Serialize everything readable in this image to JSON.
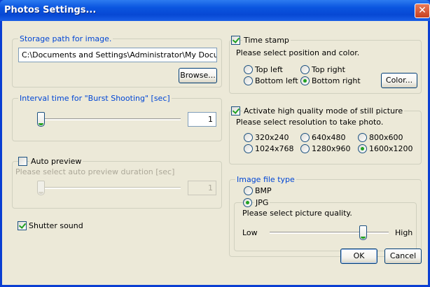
{
  "window": {
    "title": "Photos Settings...",
    "close_glyph": "✕"
  },
  "storage": {
    "group_label": "Storage path for image.",
    "path_value": "C:\\Documents and Settings\\Administrator\\My Documents",
    "browse_label": "Browse..."
  },
  "burst": {
    "group_label": "Interval time for \"Burst Shooting\" [sec]",
    "value": "1",
    "slider_level": 0
  },
  "auto_preview": {
    "checkbox_label": "Auto preview",
    "checked": false,
    "hint": "Please select auto preview duration [sec]",
    "value": "1",
    "slider_level": 0
  },
  "shutter": {
    "checkbox_label": "Shutter sound",
    "checked": true
  },
  "time_stamp": {
    "checkbox_label": "Time stamp",
    "checked": true,
    "instruction": "Please select position and color.",
    "positions": [
      "Top left",
      "Top right",
      "Bottom left",
      "Bottom right"
    ],
    "selected": "Bottom right",
    "color_button_label": "Color..."
  },
  "high_quality": {
    "checkbox_label": "Activate high quality mode of still picture",
    "checked": true,
    "instruction": "Please select resolution to take photo.",
    "resolutions": [
      "320x240",
      "640x480",
      "800x600",
      "1024x768",
      "1280x960",
      "1600x1200"
    ],
    "selected": "1600x1200"
  },
  "file_type": {
    "group_label": "Image file type",
    "options": [
      "BMP",
      "JPG"
    ],
    "selected": "JPG",
    "quality_instruction": "Please select picture quality.",
    "quality_low": "Low",
    "quality_high": "High",
    "quality_level": 0.78
  },
  "footer": {
    "ok_label": "OK",
    "cancel_label": "Cancel"
  },
  "colors": {
    "titlebar": "#0b56e0",
    "dialog_bg": "#ece9d8",
    "group_label": "#0046d5",
    "check_mark": "#21a121"
  }
}
